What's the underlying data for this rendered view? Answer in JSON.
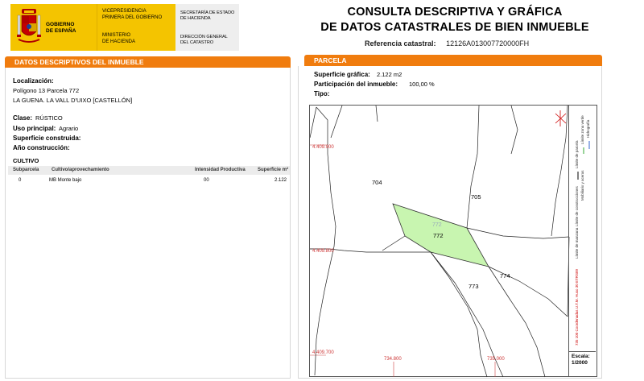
{
  "header": {
    "gobierno": [
      "GOBIERNO",
      "DE ESPAÑA"
    ],
    "vicepresidencia": [
      "VICEPRESIDENCIA",
      "PRIMERA DEL GOBIERNO"
    ],
    "ministerio": [
      "MINISTERIO",
      "DE HACIENDA"
    ],
    "secretaria": [
      "SECRETARÍA DE ESTADO",
      "DE HACIENDA"
    ],
    "direccion": [
      "DIRECCIÓN GENERAL",
      "DEL CATASTRO"
    ],
    "title_line1": "CONSULTA DESCRIPTIVA Y GRÁFICA",
    "title_line2": "DE DATOS CATASTRALES DE BIEN INMUEBLE",
    "ref_label": "Referencia catastral:",
    "ref_value": "12126A013007720000FH"
  },
  "left": {
    "section_title": "DATOS DESCRIPTIVOS DEL INMUEBLE",
    "localizacion_label": "Localización:",
    "localizacion_line1": "Polígono 13 Parcela 772",
    "localizacion_line2": "LA GUENA. LA VALL D'UIXO [CASTELLÓN]",
    "clase_label": "Clase:",
    "clase_value": "RÚSTICO",
    "uso_label": "Uso principal:",
    "uso_value": "Agrario",
    "superficie_label": "Superficie construida:",
    "anio_label": "Año construcción:",
    "cultivo_title": "CULTIVO",
    "cultivo_headers": [
      "Subparcela",
      "Cultivo/aprovechamiento",
      "Intensidad Productiva",
      "Superficie m²"
    ],
    "cultivo_rows": [
      [
        "0",
        "MB Monte bajo",
        "00",
        "2.122"
      ]
    ]
  },
  "right": {
    "section_title": "PARCELA",
    "superficie_label": "Superficie gráfica:",
    "superficie_value": "2.122 m2",
    "participacion_label": "Participación del inmueble:",
    "participacion_value": "100,00 %",
    "tipo_label": "Tipo:"
  },
  "map": {
    "parcel_labels": [
      "704",
      "705",
      "772",
      "773",
      "774"
    ],
    "coord_labels": [
      "4.409.900",
      "4.409.800",
      "4.409.700",
      "734.800",
      "735.000"
    ],
    "legend_items": [
      "Límite de parcela",
      "Límite de construcciones",
      "Mobiliario y aceras",
      "Límite zona verde",
      "Hidrografía",
      "Límite de manzana"
    ],
    "legend_note": "735 100 Coordenadas U.T.M. Huso 30 ETRS89",
    "scale_label": "Escala:",
    "scale_value": "1/2000",
    "selected_fill": "#c8f5b0"
  }
}
